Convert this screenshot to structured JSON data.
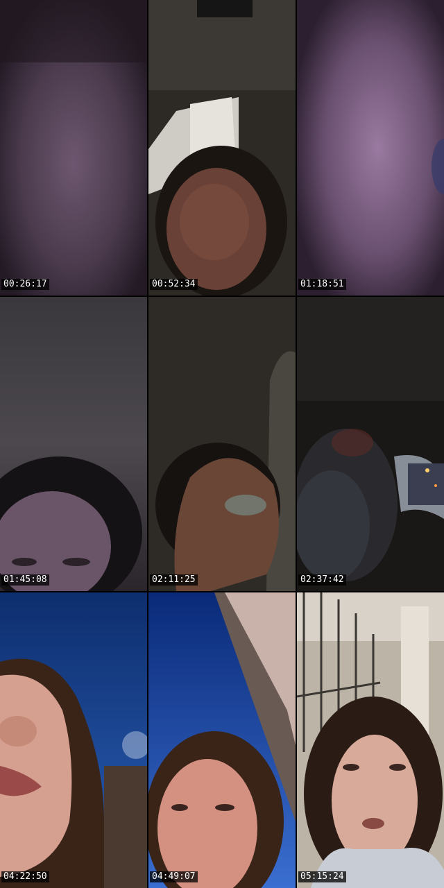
{
  "frames": [
    {
      "timestamp": "00:26:17"
    },
    {
      "timestamp": "00:52:34"
    },
    {
      "timestamp": "01:18:51"
    },
    {
      "timestamp": "01:45:08"
    },
    {
      "timestamp": "02:11:25"
    },
    {
      "timestamp": "02:37:42"
    },
    {
      "timestamp": "04:22:50"
    },
    {
      "timestamp": "04:49:07"
    },
    {
      "timestamp": "05:15:24"
    }
  ]
}
